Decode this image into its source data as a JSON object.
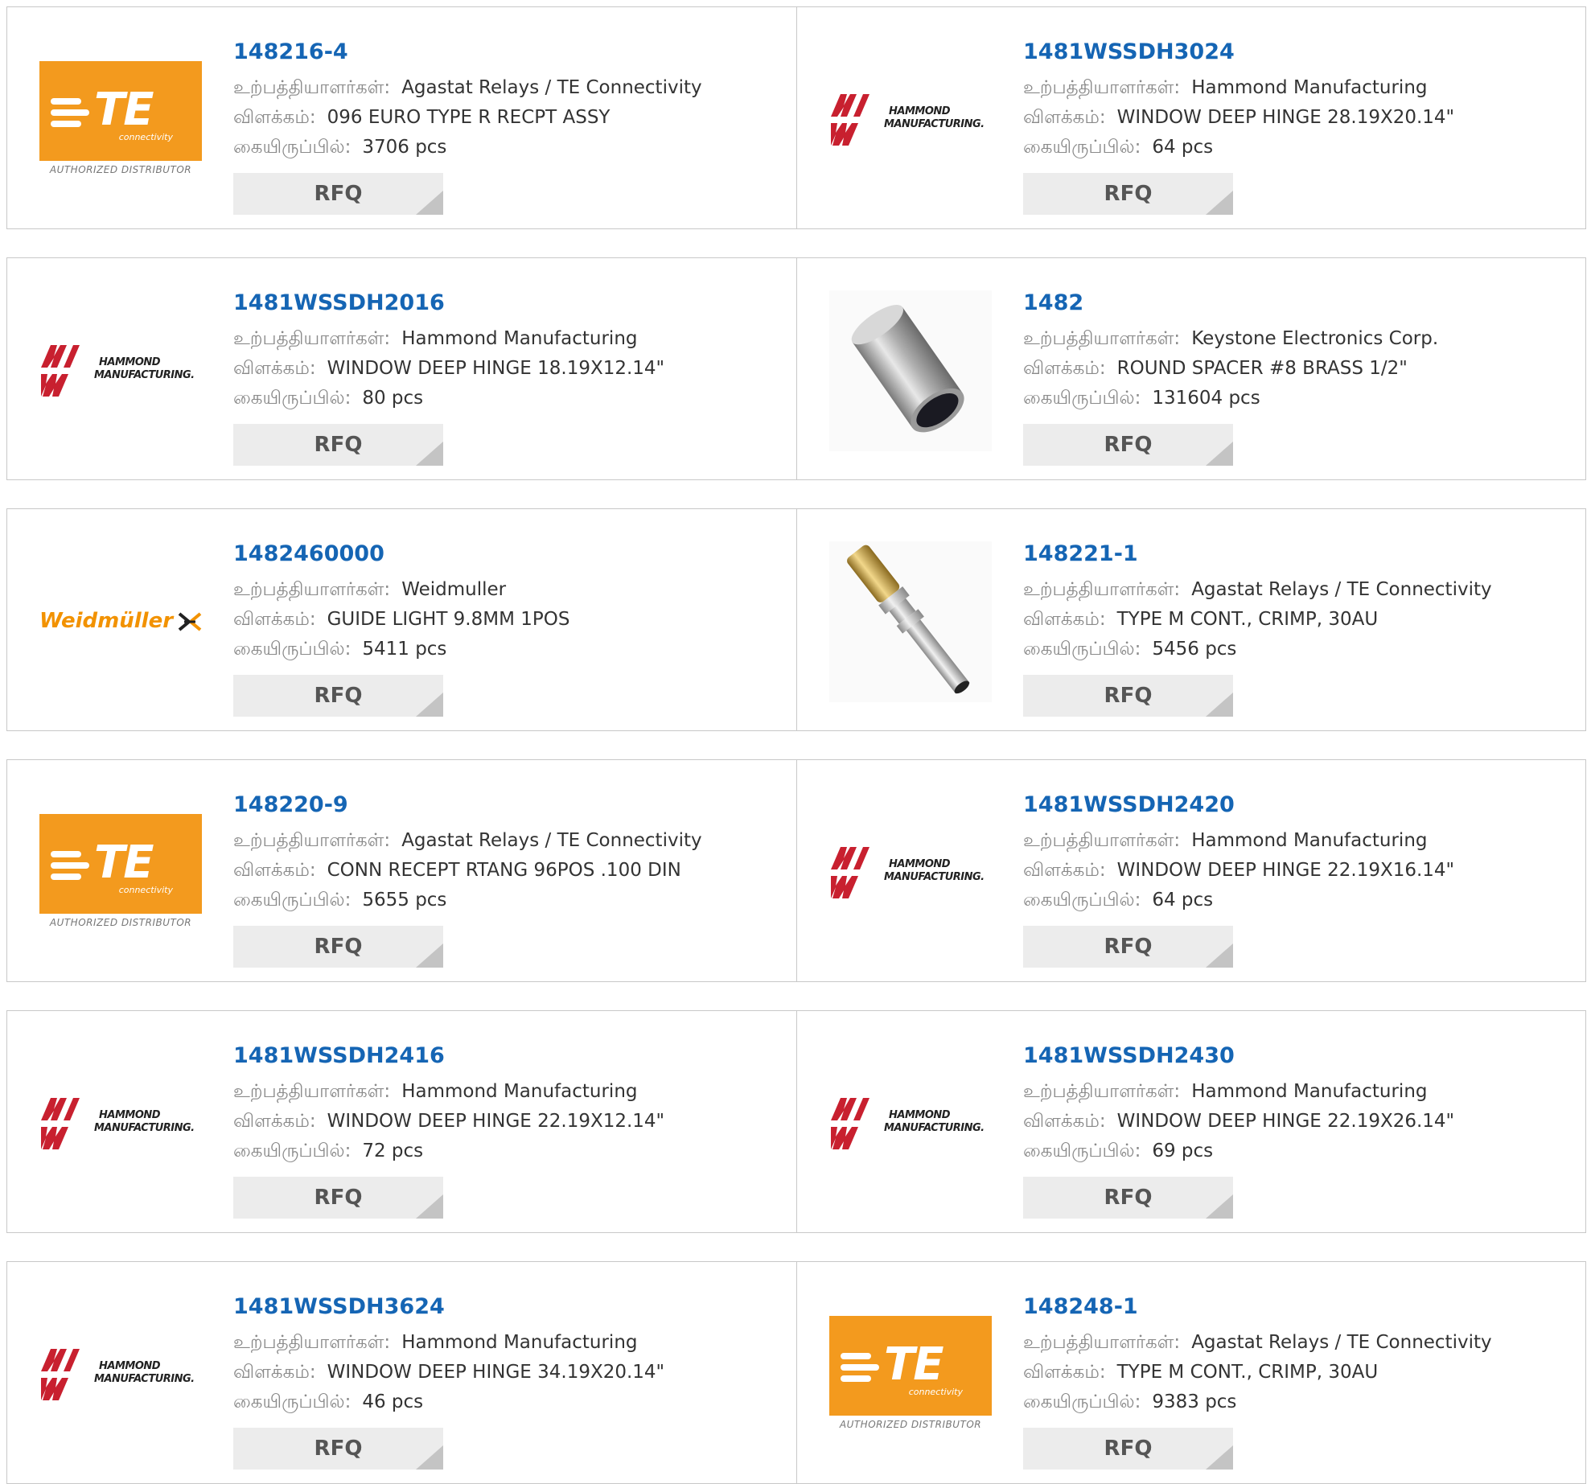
{
  "labels": {
    "manufacturer": "உற்பத்தியாளர்கள்:",
    "description": "விளக்கம்:",
    "stock": "கையிருப்பில்:",
    "rfq": "RFQ"
  },
  "logos": {
    "te_mark": "TE",
    "te_sub": "connectivity",
    "te_dist": "AUTHORIZED DISTRIBUTOR",
    "hammond_1": "HAMMOND",
    "hammond_2": "MANUFACTURING.",
    "weidmuller": "Weidmüller"
  },
  "colors": {
    "part_link": "#1565b4",
    "te_orange": "#f39a1e",
    "hammond_red": "#c8202f",
    "weidmuller_orange": "#f29200"
  },
  "products": [
    {
      "part": "148216-4",
      "logo": "te-logo",
      "manufacturer": "Agastat Relays / TE Connectivity",
      "description": "096 EURO TYPE R RECPT ASSY",
      "stock": "3706 pcs"
    },
    {
      "part": "1481WSSDH3024",
      "logo": "hammond-logo",
      "manufacturer": "Hammond Manufacturing",
      "description": "WINDOW DEEP HINGE 28.19X20.14\"",
      "stock": "64 pcs"
    },
    {
      "part": "1481WSSDH2016",
      "logo": "hammond-logo",
      "manufacturer": "Hammond Manufacturing",
      "description": "WINDOW DEEP HINGE 18.19X12.14\"",
      "stock": "80 pcs"
    },
    {
      "part": "1482",
      "logo": "spacer-photo",
      "manufacturer": "Keystone Electronics Corp.",
      "description": "ROUND SPACER #8 BRASS 1/2\"",
      "stock": "131604 pcs"
    },
    {
      "part": "1482460000",
      "logo": "weidmuller-logo",
      "manufacturer": "Weidmuller",
      "description": "GUIDE LIGHT 9.8MM 1POS",
      "stock": "5411 pcs"
    },
    {
      "part": "148221-1",
      "logo": "contact-photo",
      "manufacturer": "Agastat Relays / TE Connectivity",
      "description": "TYPE M CONT., CRIMP, 30AU",
      "stock": "5456 pcs"
    },
    {
      "part": "148220-9",
      "logo": "te-logo",
      "manufacturer": "Agastat Relays / TE Connectivity",
      "description": "CONN RECEPT RTANG 96POS .100 DIN",
      "stock": "5655 pcs"
    },
    {
      "part": "1481WSSDH2420",
      "logo": "hammond-logo",
      "manufacturer": "Hammond Manufacturing",
      "description": "WINDOW DEEP HINGE 22.19X16.14\"",
      "stock": "64 pcs"
    },
    {
      "part": "1481WSSDH2416",
      "logo": "hammond-logo",
      "manufacturer": "Hammond Manufacturing",
      "description": "WINDOW DEEP HINGE 22.19X12.14\"",
      "stock": "72 pcs"
    },
    {
      "part": "1481WSSDH2430",
      "logo": "hammond-logo",
      "manufacturer": "Hammond Manufacturing",
      "description": "WINDOW DEEP HINGE 22.19X26.14\"",
      "stock": "69 pcs"
    },
    {
      "part": "1481WSSDH3624",
      "logo": "hammond-logo",
      "manufacturer": "Hammond Manufacturing",
      "description": "WINDOW DEEP HINGE 34.19X20.14\"",
      "stock": "46 pcs"
    },
    {
      "part": "148248-1",
      "logo": "te-logo",
      "manufacturer": "Agastat Relays / TE Connectivity",
      "description": "TYPE M CONT., CRIMP, 30AU",
      "stock": "9383 pcs"
    }
  ]
}
